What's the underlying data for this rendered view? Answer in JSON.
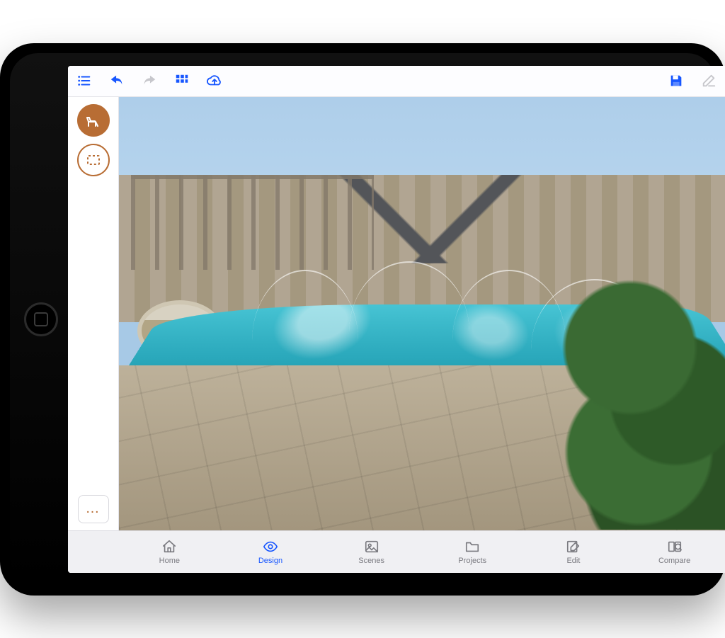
{
  "toolbar": {
    "icons": [
      "list",
      "undo",
      "redo",
      "grid",
      "cloud"
    ],
    "right_icons": [
      "save",
      "edit-note"
    ]
  },
  "siderail": {
    "tool_furniture": "furniture",
    "tool_select": "select-rect",
    "more": "…"
  },
  "tabs": [
    {
      "key": "home",
      "label": "Home",
      "icon": "home",
      "active": false
    },
    {
      "key": "design",
      "label": "Design",
      "icon": "eye",
      "active": true
    },
    {
      "key": "scenes",
      "label": "Scenes",
      "icon": "image",
      "active": false
    },
    {
      "key": "projects",
      "label": "Projects",
      "icon": "folder",
      "active": false
    },
    {
      "key": "edit",
      "label": "Edit",
      "icon": "compose",
      "active": false
    },
    {
      "key": "compare",
      "label": "Compare",
      "icon": "compare",
      "active": false
    }
  ]
}
